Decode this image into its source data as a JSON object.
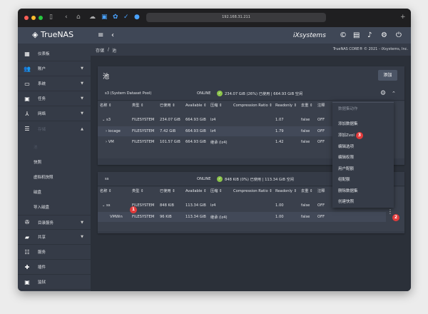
{
  "browser": {
    "url": "192.168.31.211"
  },
  "header": {
    "logo": "TrueNAS",
    "logo_sub": "CORE",
    "brand": "iXsystems"
  },
  "breadcrumb": {
    "parent": "存储",
    "sep": "/",
    "current": "池",
    "copyright": "TrueNAS CORE® © 2021 - iXsystems, Inc."
  },
  "sidebar": {
    "items": [
      {
        "label": "仪表板",
        "icon": "dashboard-icon"
      },
      {
        "label": "账户",
        "icon": "people-icon"
      },
      {
        "label": "系统",
        "icon": "laptop-icon"
      },
      {
        "label": "任务",
        "icon": "calendar-icon"
      },
      {
        "label": "网络",
        "icon": "network-icon"
      },
      {
        "label": "存储",
        "icon": "storage-icon"
      },
      {
        "label": "目录服务",
        "icon": "directory-icon"
      },
      {
        "label": "共享",
        "icon": "share-folder-icon"
      },
      {
        "label": "服务",
        "icon": "sliders-icon"
      },
      {
        "label": "插件",
        "icon": "puzzle-icon"
      },
      {
        "label": "监狱",
        "icon": "jail-icon"
      }
    ],
    "storage_sub": [
      "池",
      "快照",
      "虚拟机快照",
      "磁盘",
      "导入磁盘"
    ]
  },
  "page": {
    "title": "池",
    "add_label": "添加"
  },
  "columns": [
    "名称 ⇕",
    "类型 ⇕",
    "已使用 ⇕",
    "Available ⇕",
    "压缩 ⇕",
    "Compression Ratio ⇕",
    "Readonly ⇕",
    "去重 ⇕",
    "注释"
  ],
  "pools": [
    {
      "name": "s3  (System Dataset Pool)",
      "status": "ONLINE",
      "usage": "234.07 GiB (26%) 已使用 | 664.93 GiB 空闲",
      "rows": [
        [
          "⌄ s3",
          "FILESYSTEM",
          "234.07 GiB",
          "664.93 GiB",
          "lz4",
          "1.07",
          "false",
          "OFF"
        ],
        [
          "› iocage",
          "FILESYSTEM",
          "7.42 GiB",
          "664.93 GiB",
          "lz4",
          "1.79",
          "false",
          "OFF"
        ],
        [
          "› VM",
          "FILESYSTEM",
          "101.57 GiB",
          "664.93 GiB",
          "继承 (lz4)",
          "1.42",
          "false",
          "OFF"
        ]
      ]
    },
    {
      "name": "ss",
      "status": "ONLINE",
      "usage": "848 KiB (0%) 已使用 | 113.34 GiB 空闲",
      "rows": [
        [
          "⌄ ss",
          "FILESYSTEM",
          "848 KiB",
          "113.34 GiB",
          "lz4",
          "1.00",
          "false",
          "OFF"
        ],
        [
          "VMWin",
          "FILESYSTEM",
          "96 KiB",
          "113.34 GiB",
          "继承 (lz4)",
          "1.00",
          "false",
          "OFF"
        ]
      ]
    }
  ],
  "menu": {
    "header": "数据集动作",
    "items": [
      "添加数据集",
      "添加Zvol",
      "编辑选项",
      "编辑权限",
      "用户配额",
      "组配额",
      "删除数据集",
      "创建快照"
    ]
  },
  "badges": [
    "1",
    "2",
    "3"
  ],
  "colors": {
    "accent": "#e33b3b",
    "online": "#8bc34a"
  }
}
